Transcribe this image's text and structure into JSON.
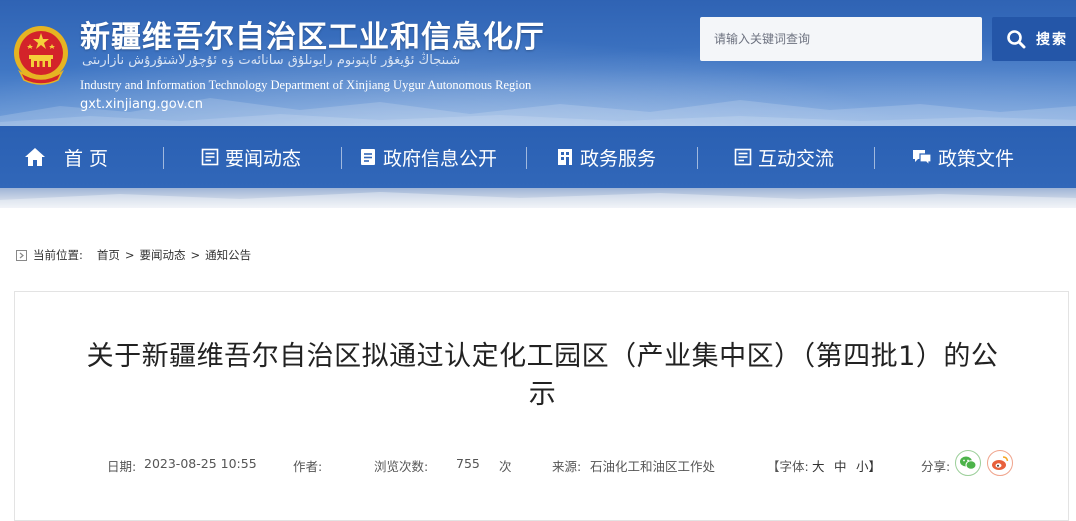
{
  "header": {
    "title_cn": "新疆维吾尔自治区工业和信息化厅",
    "title_ug": "شىنجاڭ ئۇيغۇر ئاپتونوم رايونلۇق سانائەت ۋە ئۇچۇرلاشتۇرۇش نازارىتى",
    "title_en": "Industry and Information Technology Department of Xinjiang Uygur Autonomous Region",
    "url": "gxt.xinjiang.gov.cn",
    "emblem": "national-emblem-icon"
  },
  "search": {
    "placeholder": "请输入关键词查询",
    "button_label": "搜索"
  },
  "nav": {
    "items": [
      {
        "label": "首 页",
        "icon": "home-icon"
      },
      {
        "label": "要闻动态",
        "icon": "news-icon"
      },
      {
        "label": "政府信息公开",
        "icon": "document-icon"
      },
      {
        "label": "政务服务",
        "icon": "service-icon"
      },
      {
        "label": "互动交流",
        "icon": "interaction-icon"
      },
      {
        "label": "政策文件",
        "icon": "chat-icon"
      }
    ]
  },
  "breadcrumb": {
    "label": "当前位置:",
    "items": [
      "首页",
      "要闻动态",
      "通知公告"
    ],
    "separator": ">"
  },
  "article": {
    "title_line1": "关于新疆维吾尔自治区拟通过认定化工园区（产业集中区）（第四批1）的公",
    "title_line2": "示",
    "date_label": "日期:",
    "date": "2023-08-25 10:55",
    "author_label": "作者:",
    "author": "",
    "views_label": "浏览次数:",
    "views": "755",
    "views_unit": "次",
    "source_label": "来源:",
    "source": "石油化工和油区工作处",
    "font_prefix": "【字体:",
    "font_large": "大",
    "font_medium": "中",
    "font_small": "小】",
    "share_label": "分享:"
  },
  "colors": {
    "nav_blue": "#2a60b3",
    "search_button": "#2456a8",
    "wechat_green": "#4cb34a",
    "weibo_orange": "#e8613c"
  }
}
